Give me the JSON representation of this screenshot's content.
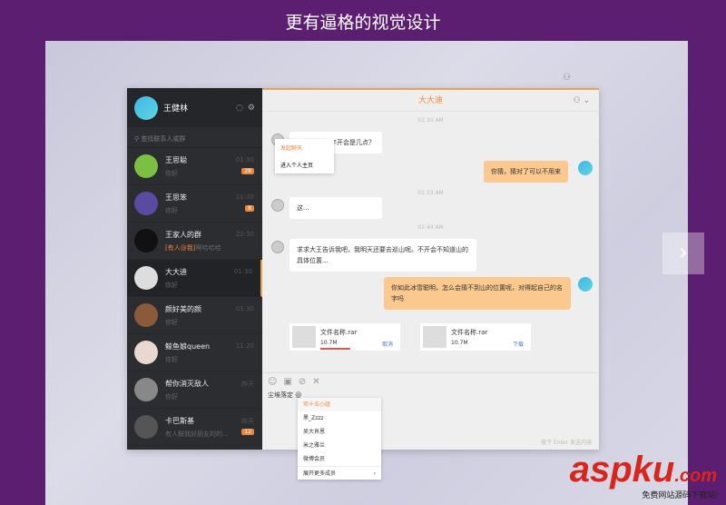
{
  "banner": "更有逼格的视觉设计",
  "user": {
    "name": "王健林"
  },
  "search_placeholder": "查找联系人或群",
  "contacts": [
    {
      "name": "王思聪",
      "preview": "你好",
      "time": "01:30",
      "badge": "28",
      "color": "#7bc043"
    },
    {
      "name": "王思笨",
      "preview": "你好",
      "time": "11:30",
      "badge": "8",
      "color": "#5a4aa0"
    },
    {
      "name": "王家人的群",
      "tag": "[有人@我]",
      "preview": "啊哈哈哈",
      "time": "22:30",
      "color": "#111"
    },
    {
      "name": "大大迪",
      "preview": "你好",
      "time": "01:30",
      "color": "#ddd"
    },
    {
      "name": "颜好美的颜",
      "preview": "你好",
      "time": "01:30",
      "color": "#8a5a3a"
    },
    {
      "name": "鲸鱼娘queen",
      "preview": "你好",
      "time": "11:20",
      "color": "#e8d8d0"
    },
    {
      "name": "帮你消灭敌人",
      "preview": "你好",
      "time": "昨天",
      "color": "#888"
    },
    {
      "name": "卡巴斯基",
      "preview": "有人解我好朋友的的...",
      "time": "昨天",
      "badge": "12",
      "color": "#555"
    }
  ],
  "chat": {
    "title": "大大迪",
    "timestamps": [
      "01:30 AM",
      "01:33 AM",
      "01:44 AM"
    ],
    "messages": [
      {
        "text": "...年开会是几点？"
      },
      {
        "text": "你猜，猜对了可以不用来"
      },
      {
        "text": "这..."
      },
      {
        "text": "求求大王告诉我吧，我明天还要去巡山呢。不开会不知道山的具体位置..."
      },
      {
        "text": "你如此冰雪聪明，怎么会猜不到山的位置呢，对得起自己的名字吗"
      }
    ],
    "context_menu": [
      "发起聊天",
      "进入个人主页"
    ],
    "files": [
      {
        "name": "文件名称.rar",
        "size": "10.7M",
        "action": "取消",
        "progress": 0.4
      },
      {
        "name": "文件名称.rar",
        "size": "10.7M",
        "action": "下载"
      }
    ],
    "input_text": "尘埃落定 @",
    "hint": "按下 Enter 发送内容",
    "mentions": [
      "邓十五小组",
      "黑_Zzzz",
      "吴大肖恩",
      "米之雅兰",
      "微博会员",
      "展开更多成员"
    ]
  },
  "watermark": {
    "main": "aspku",
    "suffix": ".com",
    "sub": "免费网站源码下载站!"
  }
}
